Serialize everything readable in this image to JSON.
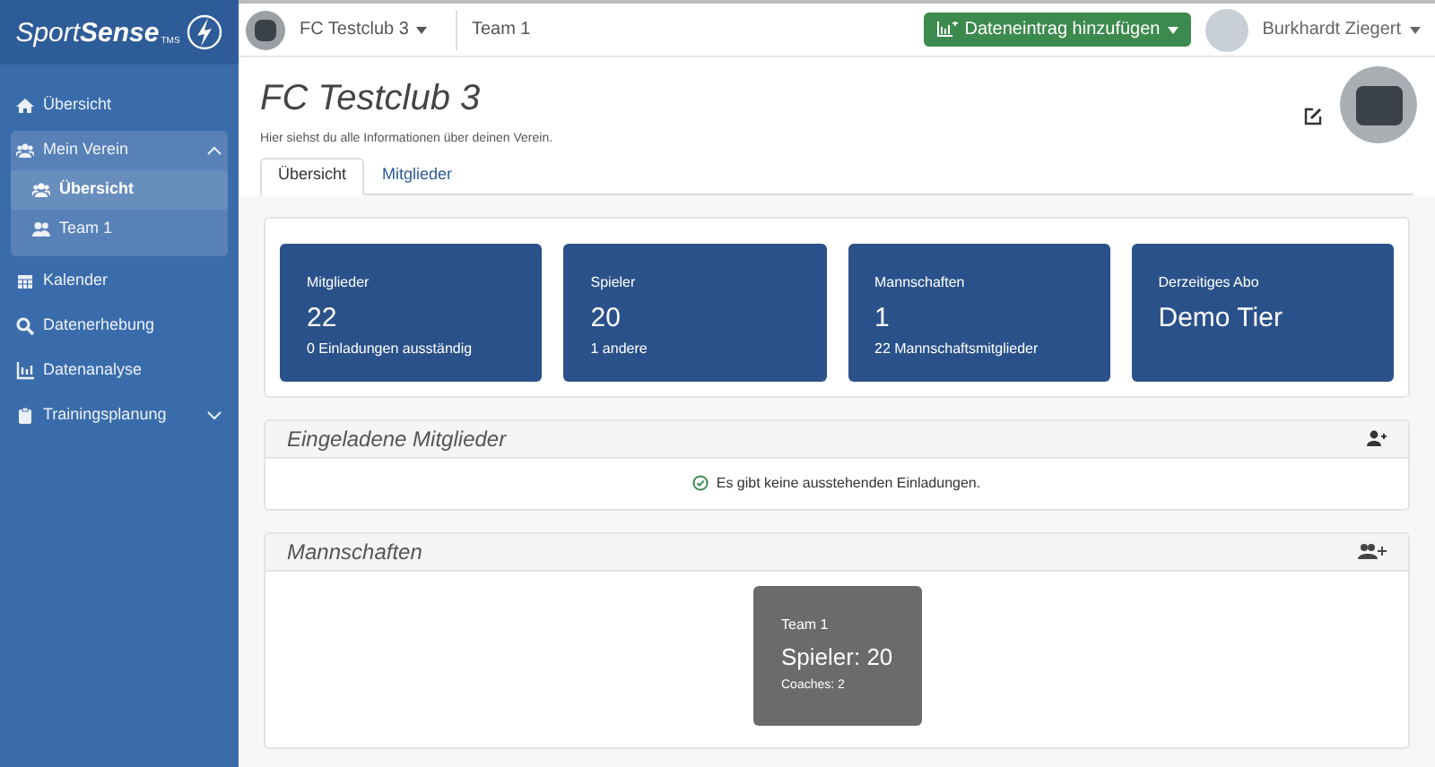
{
  "brand": {
    "name_light": "Sport",
    "name_bold": "Sense",
    "sub": "TMS"
  },
  "topbar": {
    "club": "FC Testclub 3",
    "team": "Team 1",
    "action_button": "Dateneintrag hinzufügen",
    "user": "Burkhardt Ziegert"
  },
  "sidebar": {
    "items": [
      {
        "kind": "home",
        "label": "Übersicht",
        "selected": false
      },
      {
        "kind": "club",
        "label": "Mein Verein",
        "selected": false,
        "expanded": true,
        "children": [
          {
            "kind": "club",
            "label": "Übersicht",
            "selected": true
          },
          {
            "kind": "team",
            "label": "Team 1",
            "selected": false
          }
        ]
      },
      {
        "kind": "calendar",
        "label": "Kalender",
        "selected": false
      },
      {
        "kind": "search",
        "label": "Datenerhebung",
        "selected": false
      },
      {
        "kind": "chart",
        "label": "Datenanalyse",
        "selected": false
      },
      {
        "kind": "clipboard",
        "label": "Trainingsplanung",
        "selected": false,
        "expanded": false
      }
    ]
  },
  "page": {
    "title": "FC Testclub 3",
    "subtitle": "Hier siehst du alle Informationen über deinen Verein."
  },
  "tabs": [
    {
      "label": "Übersicht",
      "selected": true
    },
    {
      "label": "Mitglieder",
      "selected": false
    }
  ],
  "stats": [
    {
      "label": "Mitglieder",
      "value": "22",
      "note": "0 Einladungen ausständig"
    },
    {
      "label": "Spieler",
      "value": "20",
      "note": "1 andere"
    },
    {
      "label": "Mannschaften",
      "value": "1",
      "note": "22 Mannschaftsmitglieder"
    },
    {
      "label": "Derzeitiges Abo",
      "value": "Demo Tier"
    }
  ],
  "invited": {
    "title": "Eingeladene Mitglieder",
    "message": "Es gibt keine ausstehenden Einladungen."
  },
  "teams": {
    "title": "Mannschaften",
    "items": [
      {
        "name": "Team 1",
        "players": "Spieler: 20",
        "coaches": "Coaches: 2"
      }
    ]
  }
}
